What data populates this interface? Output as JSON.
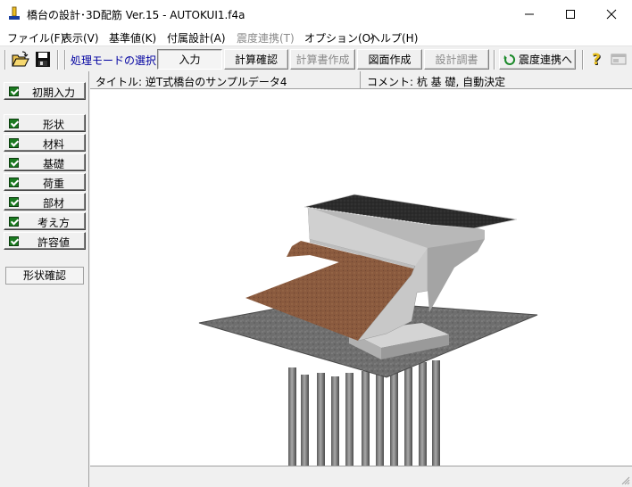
{
  "window": {
    "title": "橋台の設計･3D配筋 Ver.15 - AUTOKUI1.f4a",
    "minimize_glyph": "—",
    "maximize_glyph": "☐",
    "close_glyph": "✕"
  },
  "menu": [
    {
      "label": "ファイル(F)",
      "enabled": true
    },
    {
      "label": "表示(V)",
      "enabled": true
    },
    {
      "label": "基準値(K)",
      "enabled": true
    },
    {
      "label": "付属設計(A)",
      "enabled": true
    },
    {
      "label": "震度連携(T)",
      "enabled": false
    },
    {
      "label": "オプション(O)",
      "enabled": true
    },
    {
      "label": "ヘルプ(H)",
      "enabled": true
    }
  ],
  "toolbar": {
    "open_icon": "folder-open-icon",
    "save_icon": "floppy-disk-icon",
    "mode_label": "処理モードの選択",
    "buttons": [
      {
        "label": "入力",
        "state": "pressed"
      },
      {
        "label": "計算確認",
        "state": "enabled"
      },
      {
        "label": "計算書作成",
        "state": "disabled"
      },
      {
        "label": "図面作成",
        "state": "enabled"
      },
      {
        "label": "設計調書",
        "state": "disabled"
      }
    ],
    "seismic_button": "震度連携へ",
    "help_icon": "help-question-icon",
    "disabled_icon": "dialog-icon"
  },
  "sidebar": {
    "initial_input": "初期入力",
    "items": [
      "形状",
      "材料",
      "基礎",
      "荷重",
      "部材",
      "考え方",
      "許容値"
    ],
    "shape_confirm": "形状確認"
  },
  "infobar": {
    "title": "タイトル: 逆T式橋台のサンプルデータ4",
    "comment": "コメント: 杭 基 礎, 自動決定"
  },
  "viewport": {
    "scene": "abutment-3d-model",
    "pile_count": 12
  },
  "colors": {
    "mode_label": "#0000a0",
    "check": "#1b7a20",
    "concrete": "#bdbdbd",
    "soil": "#8a5a3e",
    "ground": "#6e6e6e",
    "deck": "#2b2b2b"
  }
}
